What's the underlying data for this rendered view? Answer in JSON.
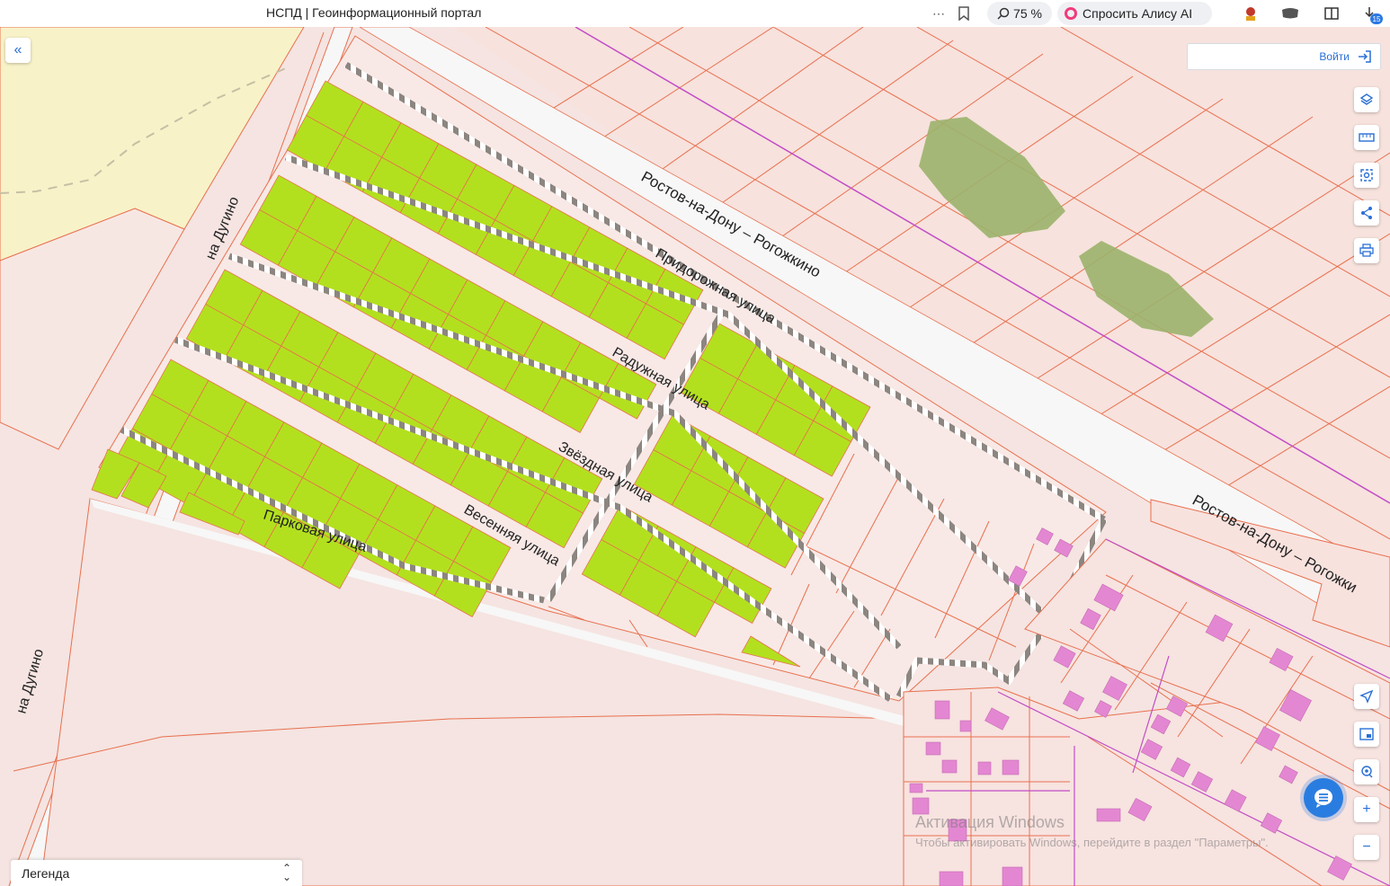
{
  "browser": {
    "page_title": "НСПД | Геоинформационный портал",
    "zoom": "75 %",
    "alice_label": "Спросить Алису AI",
    "downloads_count": "15"
  },
  "header": {
    "login_label": "Войти"
  },
  "map": {
    "street_labels": {
      "dugino_upper": "на Дугино",
      "dugino_lower": "на Дугино",
      "rostov_upper": "Ростов-на-Дону – Рогожкино",
      "rostov_lower": "Ростов-на-Дону – Рогожки",
      "pridorozhnaya": "Придорожная улица",
      "raduzhnaya": "Радужная улица",
      "zvezdnaya": "Звёздная улица",
      "vesennyaya": "Весенняя улица",
      "parkovaya": "Парковая улица"
    },
    "colors": {
      "background": "#f5e4e1",
      "parcel_outline": "#e8704f",
      "highlighted_parcel": "#b3e01e",
      "building": "#e487d2",
      "forest": "#9bb26b",
      "road": "#f7f7f7",
      "farmland": "#f8f2c8",
      "utility_line": "#c24cc7"
    }
  },
  "legend": {
    "label": "Легенда"
  },
  "watermark": {
    "line1": "Активация Windows",
    "line2": "Чтобы активировать Windows, перейдите в раздел \"Параметры\"."
  }
}
